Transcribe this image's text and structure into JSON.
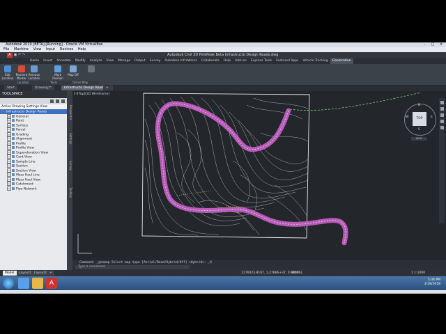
{
  "vbox": {
    "title": "Autodesk 2019 [BETA] [Running] - Oracle VM VirtualBox",
    "menu": [
      "File",
      "Machine",
      "View",
      "Input",
      "Devices",
      "Help"
    ]
  },
  "app": {
    "title": "Autodesk Civil 3D PinkPeak Beta   Infrastructo Design Roads.dwg",
    "ribbon_tabs": [
      "Home",
      "Insert",
      "Annotate",
      "Modify",
      "Analyze",
      "View",
      "Manage",
      "Output",
      "Survey",
      "Autodesk InfraWorks",
      "Collaborate",
      "Help",
      "Add-ins",
      "Express Tools",
      "Featured Apps",
      "Vehicle Tracking",
      "Geolocation"
    ],
    "active_tab": "Geolocation",
    "ribbon_buttons": [
      {
        "label": "Edit Location",
        "icon": "map-pin-icon"
      },
      {
        "label": "Reorient Marker",
        "icon": "marker-icon"
      },
      {
        "label": "Remove Location",
        "icon": "remove-location-icon"
      },
      {
        "label": "Mark Position",
        "icon": "mark-position-icon"
      },
      {
        "label": "Map Off",
        "icon": "map-icon"
      },
      {
        "label": "",
        "icon": "capture-icon"
      }
    ],
    "ribbon_panels": [
      "Location",
      "Tools",
      "Online Map"
    ]
  },
  "doc_tabs": [
    "Start",
    "Drawing1*",
    "Infrastructo Design Roads*"
  ],
  "active_doc": "Infrastructo Design Roads*",
  "toolspace": {
    "title": "TOOLSPACE",
    "sub": "Active Drawing Settings View",
    "root": "Infrastructo Design Roads",
    "items": [
      "General",
      "Point",
      "Surface",
      "Parcel",
      "Grading",
      "Alignment",
      "Profile",
      "Profile View",
      "Superelevation View",
      "Cant View",
      "Sample Line",
      "Section",
      "Section View",
      "Mass Haul Line",
      "Mass Haul View",
      "Catchment",
      "Pipe Network"
    ],
    "side_tabs": [
      "Prospector",
      "Settings",
      "Survey",
      "Toolbox"
    ]
  },
  "viewport": {
    "label": "[-][Top][2D Wireframe]",
    "viewcube_face": "TOP",
    "viewcube_n": "N",
    "viewcube_s": "S",
    "viewcube_e": "E",
    "viewcube_w": "W",
    "ucs": "WCS"
  },
  "command": {
    "history": "Command:  _geomap  Select map type [Aerial/Road/Hybrid/Off] <Hybrid>: _H",
    "prompt": "Type a command"
  },
  "layout_tabs": [
    "Model",
    "Layout1",
    "Layout2"
  ],
  "status": {
    "coords": "1176023.8107, 1,27666+37, 0.0000",
    "model": "MODEL",
    "scale": "1 1:1000"
  },
  "clock": {
    "time": "5:34 PM",
    "date": "2/28/2018"
  },
  "colors": {
    "road": "#b85ab8",
    "contour": "#e6e6e6",
    "canvas": "#23262b"
  }
}
